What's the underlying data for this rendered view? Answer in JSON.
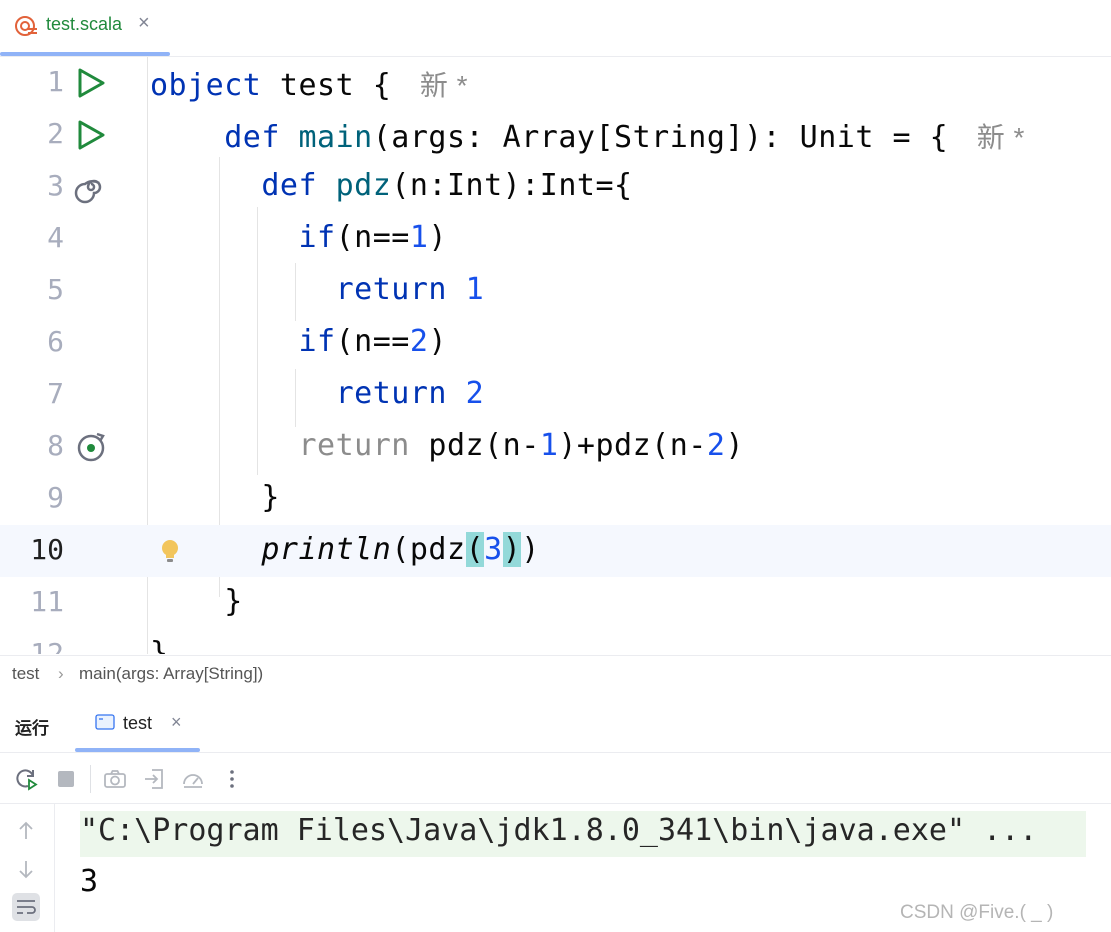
{
  "file_tab": {
    "name": "test.scala",
    "close_glyph": "×",
    "icon": "scala-file-icon"
  },
  "editor": {
    "current_line": 10,
    "line_numbers": [
      "1",
      "2",
      "3",
      "4",
      "5",
      "6",
      "7",
      "8",
      "9",
      "10",
      "11"
    ],
    "inlay_hint": "新 *",
    "gutter_icons": {
      "1": "run-icon",
      "2": "run-icon",
      "3": "recursive-call-icon",
      "8": "recursive-call-icon",
      "10": "lightbulb-icon"
    }
  },
  "breadcrumb": {
    "item1": "test",
    "sep": "›",
    "item2": "main(args: Array[String])"
  },
  "run_panel": {
    "title": "运行",
    "tab_label": "test",
    "tab_close": "×",
    "console": {
      "command": "\"C:\\Program Files\\Java\\jdk1.8.0_341\\bin\\java.exe\" ...",
      "output": "3"
    }
  },
  "watermark": "CSDN @Five.(   _  )",
  "colors": {
    "keyword": "#0033b3",
    "function": "#00627a",
    "number": "#1750eb",
    "file_name": "#208a3c",
    "current_line_bg": "#f5f8fe",
    "console_cmd_bg": "#edf7ec"
  }
}
